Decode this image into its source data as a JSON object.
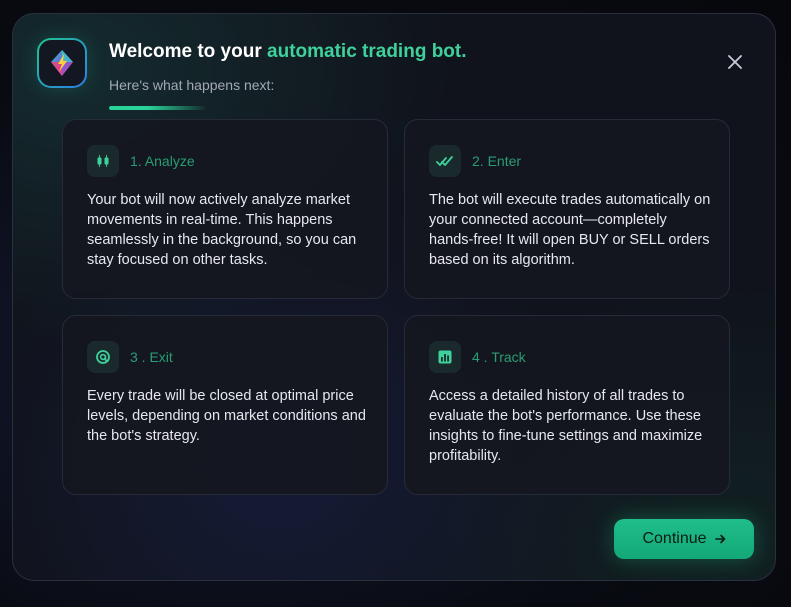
{
  "modal": {
    "title_prefix": "Welcome to your ",
    "title_accent": "automatic trading bot.",
    "subtitle": "Here's what happens next:",
    "progress_fraction": 0.4,
    "close_icon": "close-icon",
    "logo_icon": "gem-bolt-logo-icon"
  },
  "steps": [
    {
      "label": "1. Analyze",
      "icon": "candlestick-icon",
      "body": "Your bot will now actively analyze market movements in real-time. This happens seamlessly in the background, so you can stay focused on other tasks."
    },
    {
      "label": "2. Enter",
      "icon": "double-check-icon",
      "body": "The bot will execute trades automatically on your connected account—completely hands-free! It will open BUY or SELL orders based on its algorithm."
    },
    {
      "label": "3 . Exit",
      "icon": "at-target-icon",
      "body": "Every trade will be closed at optimal price levels, depending on market conditions and the bot's strategy."
    },
    {
      "label": "4 . Track",
      "icon": "bar-chart-icon",
      "body": "Access a detailed history of all trades to evaluate the bot's performance. Use these insights to fine-tune settings and maximize profitability."
    }
  ],
  "actions": {
    "continue_label": "Continue",
    "continue_icon": "arrow-right-icon"
  },
  "colors": {
    "accent": "#3fd19b",
    "step_label": "#279e74",
    "button": "#1fbe8a"
  }
}
